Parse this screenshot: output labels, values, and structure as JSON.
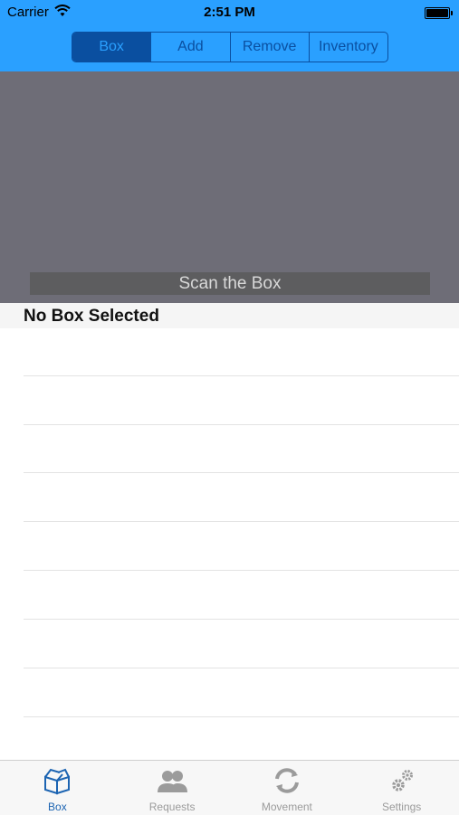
{
  "status_bar": {
    "carrier": "Carrier",
    "time": "2:51 PM"
  },
  "segments": [
    {
      "label": "Box",
      "active": true
    },
    {
      "label": "Add",
      "active": false
    },
    {
      "label": "Remove",
      "active": false
    },
    {
      "label": "Inventory",
      "active": false
    }
  ],
  "scanner": {
    "label": "Scan the Box"
  },
  "section": {
    "title": "No Box Selected"
  },
  "table": {
    "empty_rows": 8
  },
  "tabs": [
    {
      "label": "Box",
      "icon": "box-icon",
      "active": true
    },
    {
      "label": "Requests",
      "icon": "people-icon",
      "active": false
    },
    {
      "label": "Movement",
      "icon": "refresh-icon",
      "active": false
    },
    {
      "label": "Settings",
      "icon": "gears-icon",
      "active": false
    }
  ],
  "colors": {
    "nav": "#2aa0ff",
    "accent": "#0a4fa0",
    "tab_active": "#1c64b2"
  }
}
